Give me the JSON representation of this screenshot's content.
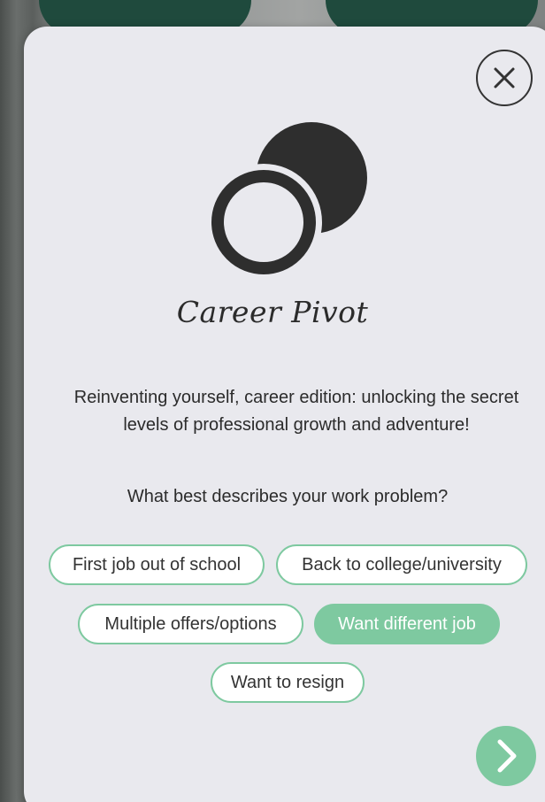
{
  "modal": {
    "title": "Career Pivot",
    "description": "Reinventing yourself, career edition: unlocking the secret levels of professional growth and adventure!",
    "question": "What best describes your work problem?",
    "close_icon": "close-icon",
    "next_icon": "chevron-right-icon",
    "logo_icon": "overlapping-circles-icon"
  },
  "options": [
    {
      "label": "First job out of school",
      "selected": false
    },
    {
      "label": "Back to college/university",
      "selected": false
    },
    {
      "label": "Multiple offers/options",
      "selected": false
    },
    {
      "label": "Want different job",
      "selected": true
    },
    {
      "label": "Want to resign",
      "selected": false
    }
  ],
  "colors": {
    "accent": "#7ec9a0",
    "card_background": "#e9e9ee",
    "text": "#2b2b2b",
    "background_button": "#1f4a3d"
  }
}
